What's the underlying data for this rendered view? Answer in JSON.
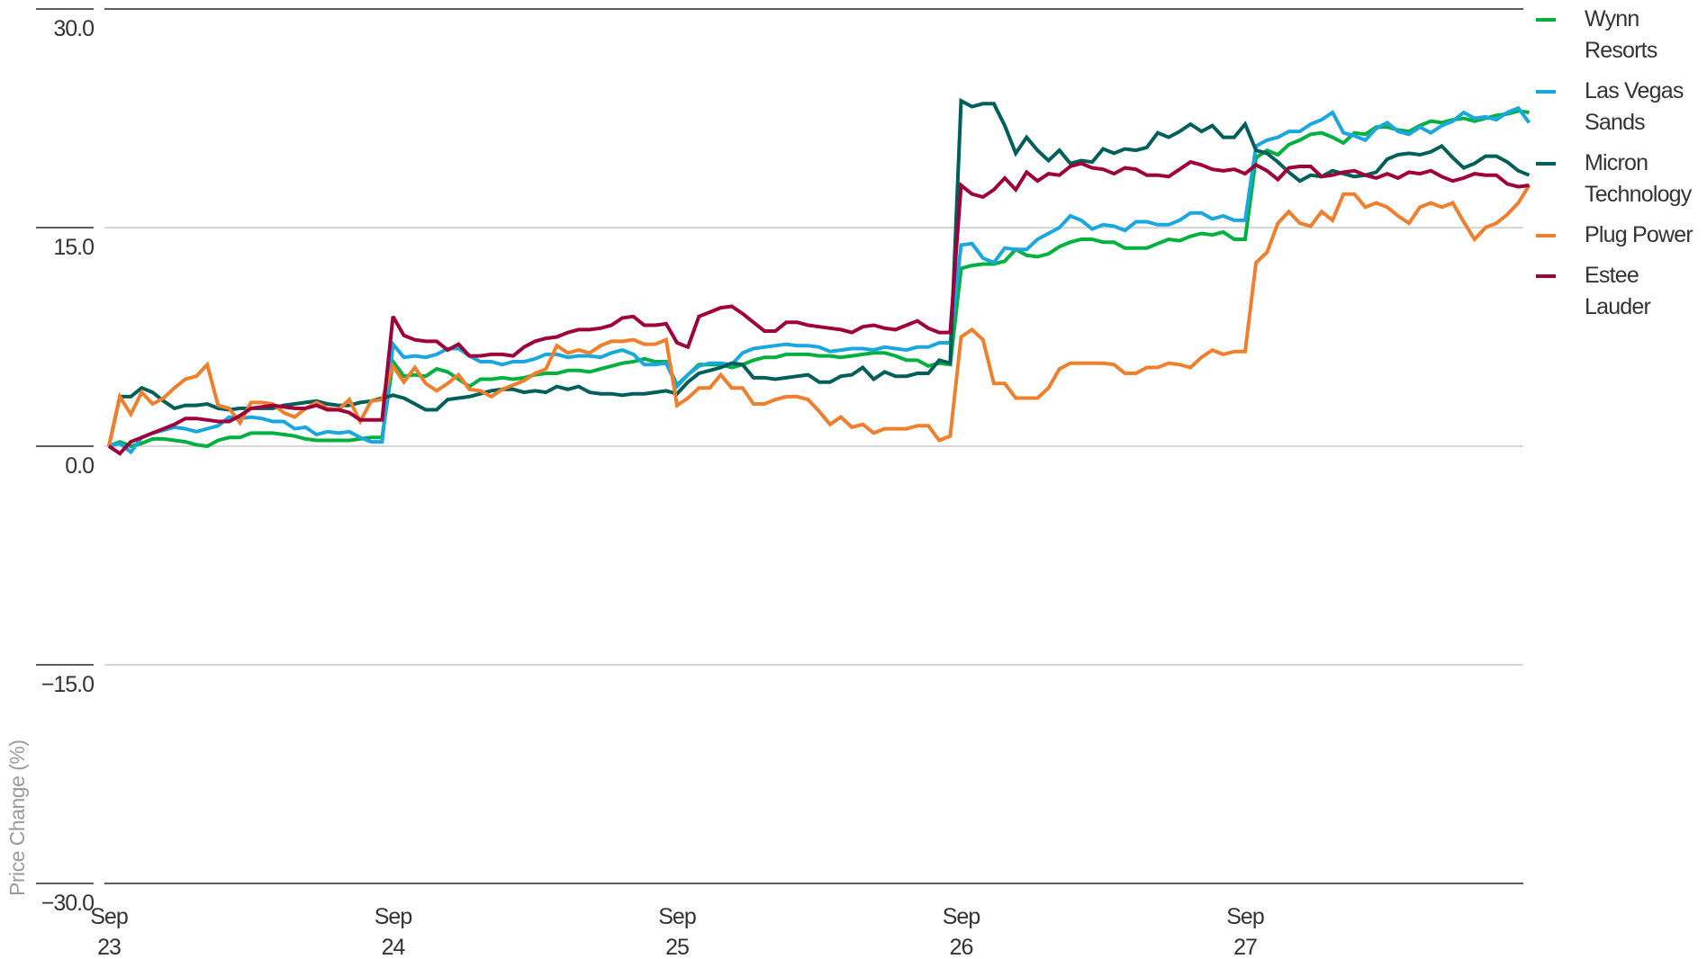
{
  "chart_data": {
    "type": "line",
    "title": "",
    "xlabel": "",
    "ylabel": "Price Change (%)",
    "ylim": [
      -30,
      30
    ],
    "yticks": [
      30,
      15,
      0,
      -15,
      -30
    ],
    "ytick_labels": [
      "30.0",
      "15.0",
      "0.0",
      "−15.0",
      "−30.0"
    ],
    "xtick_labels": [
      {
        "line1": "Sep",
        "line2": "23"
      },
      {
        "line1": "Sep",
        "line2": "24"
      },
      {
        "line1": "Sep",
        "line2": "25"
      },
      {
        "line1": "Sep",
        "line2": "26"
      },
      {
        "line1": "Sep",
        "line2": "27"
      }
    ],
    "points_per_day": 26,
    "grid": true,
    "legend_position": "right",
    "series": [
      {
        "name": "Wynn Resorts",
        "color": "#00b140",
        "values": [
          0,
          0.3,
          0,
          0.2,
          0.5,
          0.5,
          0.4,
          0.3,
          0.1,
          0,
          0.4,
          0.6,
          0.6,
          0.9,
          0.9,
          0.9,
          0.8,
          0.7,
          0.5,
          0.4,
          0.4,
          0.4,
          0.4,
          0.5,
          0.6,
          0.6,
          5.8,
          4.8,
          4.9,
          4.8,
          5.3,
          5.1,
          4.6,
          4.1,
          4.6,
          4.6,
          4.7,
          4.6,
          4.7,
          4.9,
          5.0,
          5.0,
          5.2,
          5.2,
          5.1,
          5.3,
          5.5,
          5.7,
          5.8,
          6.0,
          5.8,
          5.8,
          4.2,
          4.9,
          5.6,
          5.6,
          5.6,
          5.4,
          5.6,
          5.9,
          6.1,
          6.1,
          6.3,
          6.3,
          6.3,
          6.2,
          6.2,
          6.1,
          6.2,
          6.3,
          6.4,
          6.4,
          6.2,
          5.9,
          5.9,
          5.5,
          5.7,
          5.6,
          12.2,
          12.4,
          12.5,
          12.5,
          12.7,
          13.5,
          13.1,
          13.0,
          13.2,
          13.7,
          14.0,
          14.2,
          14.2,
          14.0,
          14.0,
          13.6,
          13.6,
          13.6,
          13.9,
          14.2,
          14.1,
          14.4,
          14.6,
          14.5,
          14.7,
          14.2,
          14.2,
          19.8,
          20.3,
          20.0,
          20.7,
          21.0,
          21.4,
          21.5,
          21.2,
          20.8,
          21.5,
          21.4,
          21.9,
          21.9,
          21.7,
          21.6,
          22.0,
          22.3,
          22.2,
          22.4,
          22.5,
          22.3,
          22.5,
          22.7,
          22.8,
          23.0,
          22.9
        ]
      },
      {
        "name": "Las Vegas Sands",
        "color": "#1aa7e0",
        "values": [
          0,
          0.2,
          -0.4,
          0.6,
          0.9,
          1.1,
          1.3,
          1.2,
          1.0,
          1.2,
          1.4,
          2.0,
          1.9,
          2.0,
          1.9,
          1.7,
          1.7,
          1.2,
          1.3,
          0.8,
          1.0,
          0.9,
          1.0,
          0.6,
          0.3,
          0.3,
          7.0,
          6.1,
          6.2,
          6.1,
          6.3,
          6.7,
          6.7,
          6.2,
          5.8,
          5.8,
          5.6,
          5.8,
          5.8,
          6.0,
          6.3,
          6.3,
          6.1,
          6.2,
          6.2,
          6.1,
          6.4,
          6.6,
          6.3,
          5.6,
          5.6,
          5.7,
          4.1,
          4.9,
          5.5,
          5.7,
          5.7,
          5.6,
          6.4,
          6.7,
          6.8,
          6.9,
          7.0,
          6.9,
          6.9,
          6.8,
          6.5,
          6.6,
          6.7,
          6.7,
          6.6,
          6.8,
          6.7,
          6.6,
          6.8,
          6.8,
          7.1,
          7.1,
          13.8,
          13.9,
          12.9,
          12.6,
          13.6,
          13.5,
          13.5,
          14.2,
          14.6,
          15.0,
          15.8,
          15.5,
          14.9,
          15.2,
          15.1,
          14.8,
          15.4,
          15.4,
          15.2,
          15.2,
          15.5,
          16.0,
          16.0,
          15.6,
          15.8,
          15.5,
          15.5,
          20.6,
          21.0,
          21.2,
          21.6,
          21.6,
          22.1,
          22.4,
          22.9,
          21.5,
          21.3,
          21.0,
          21.8,
          22.2,
          21.6,
          21.4,
          21.9,
          21.5,
          22.0,
          22.3,
          22.9,
          22.5,
          22.6,
          22.4,
          22.9,
          23.2,
          22.2
        ]
      },
      {
        "name": "Micron Technology",
        "color": "#005f5a",
        "values": [
          0,
          3.4,
          3.4,
          4.0,
          3.7,
          3.1,
          2.6,
          2.8,
          2.8,
          2.9,
          2.6,
          2.5,
          2.6,
          2.6,
          2.6,
          2.6,
          2.8,
          2.9,
          3.0,
          3.1,
          2.9,
          2.8,
          2.8,
          3.0,
          3.1,
          3.3,
          3.5,
          3.3,
          2.9,
          2.5,
          2.5,
          3.2,
          3.3,
          3.4,
          3.6,
          3.8,
          3.9,
          3.9,
          3.7,
          3.8,
          3.7,
          4.1,
          3.9,
          4.1,
          3.7,
          3.6,
          3.6,
          3.5,
          3.6,
          3.6,
          3.7,
          3.8,
          3.6,
          4.4,
          5.0,
          5.2,
          5.4,
          5.7,
          5.6,
          4.7,
          4.7,
          4.6,
          4.7,
          4.8,
          4.9,
          4.4,
          4.4,
          4.8,
          4.9,
          5.4,
          4.6,
          5.1,
          4.8,
          4.8,
          5.0,
          5.0,
          5.9,
          5.7,
          23.7,
          23.3,
          23.5,
          23.5,
          22.0,
          20.1,
          21.2,
          20.3,
          19.6,
          20.3,
          19.4,
          19.6,
          19.5,
          20.4,
          20.1,
          20.4,
          20.3,
          20.5,
          21.5,
          21.2,
          21.6,
          22.1,
          21.6,
          22.0,
          21.2,
          21.2,
          22.1,
          20.3,
          20.1,
          19.5,
          18.8,
          18.2,
          18.6,
          18.5,
          18.9,
          18.7,
          18.5,
          18.6,
          18.8,
          19.7,
          20.0,
          20.1,
          20.0,
          20.2,
          20.6,
          19.8,
          19.1,
          19.4,
          19.9,
          19.9,
          19.5,
          18.9,
          18.6
        ]
      },
      {
        "name": "Plug Power",
        "color": "#f07f2d",
        "values": [
          0,
          3.4,
          2.2,
          3.7,
          2.9,
          3.3,
          4.0,
          4.6,
          4.8,
          5.6,
          2.8,
          2.6,
          1.6,
          3.0,
          3.0,
          2.9,
          2.3,
          2.0,
          2.6,
          3.0,
          2.6,
          2.5,
          3.2,
          1.7,
          3.1,
          3.2,
          5.5,
          4.4,
          5.4,
          4.3,
          3.8,
          4.3,
          4.9,
          3.9,
          3.8,
          3.4,
          3.9,
          4.2,
          4.5,
          5.0,
          5.3,
          6.9,
          6.4,
          6.6,
          6.4,
          6.9,
          7.2,
          7.2,
          7.3,
          7.0,
          7.0,
          7.3,
          2.8,
          3.3,
          4.0,
          4.0,
          4.9,
          4.0,
          4.0,
          2.9,
          2.9,
          3.2,
          3.4,
          3.4,
          3.2,
          2.4,
          1.5,
          2.0,
          1.3,
          1.5,
          0.9,
          1.2,
          1.2,
          1.2,
          1.4,
          1.4,
          0.4,
          0.7,
          7.5,
          8.0,
          7.3,
          4.3,
          4.3,
          3.3,
          3.3,
          3.3,
          4.0,
          5.3,
          5.7,
          5.7,
          5.7,
          5.7,
          5.6,
          5.0,
          5.0,
          5.4,
          5.4,
          5.7,
          5.6,
          5.4,
          6.1,
          6.6,
          6.3,
          6.5,
          6.5,
          12.6,
          13.3,
          15.3,
          16.1,
          15.3,
          15.1,
          16.1,
          15.5,
          17.3,
          17.3,
          16.4,
          16.7,
          16.4,
          15.8,
          15.3,
          16.4,
          16.7,
          16.4,
          16.7,
          15.4,
          14.2,
          15.0,
          15.3,
          15.9,
          16.7,
          17.9
        ]
      },
      {
        "name": "Estee Lauder",
        "color": "#a0003a",
        "values": [
          0,
          -0.5,
          0.3,
          0.6,
          0.9,
          1.2,
          1.5,
          1.9,
          1.9,
          1.8,
          1.7,
          1.7,
          2.1,
          2.6,
          2.7,
          2.8,
          2.7,
          2.6,
          2.6,
          2.8,
          2.5,
          2.5,
          2.3,
          1.8,
          1.8,
          1.8,
          8.9,
          7.6,
          7.3,
          7.2,
          7.2,
          6.6,
          7.0,
          6.2,
          6.2,
          6.3,
          6.3,
          6.2,
          6.8,
          7.2,
          7.4,
          7.5,
          7.8,
          8.0,
          8.0,
          8.1,
          8.3,
          8.8,
          8.9,
          8.3,
          8.3,
          8.4,
          7.1,
          6.8,
          8.9,
          9.2,
          9.5,
          9.6,
          9.1,
          8.5,
          7.9,
          7.9,
          8.5,
          8.5,
          8.3,
          8.2,
          8.1,
          8.0,
          7.8,
          8.2,
          8.3,
          8.1,
          8.0,
          8.3,
          8.6,
          8.1,
          7.8,
          7.8,
          17.9,
          17.3,
          17.1,
          17.6,
          18.4,
          17.6,
          18.8,
          18.2,
          18.7,
          18.6,
          19.2,
          19.4,
          19.1,
          19.0,
          18.7,
          19.1,
          19.0,
          18.6,
          18.6,
          18.5,
          19.0,
          19.5,
          19.3,
          19.0,
          18.9,
          19.0,
          18.7,
          19.3,
          18.9,
          18.3,
          19.1,
          19.2,
          19.2,
          18.5,
          18.6,
          18.8,
          18.9,
          18.6,
          18.4,
          18.7,
          18.4,
          18.8,
          18.7,
          18.9,
          18.5,
          18.2,
          18.4,
          18.7,
          18.6,
          18.6,
          18.0,
          17.8,
          17.9
        ]
      }
    ]
  }
}
